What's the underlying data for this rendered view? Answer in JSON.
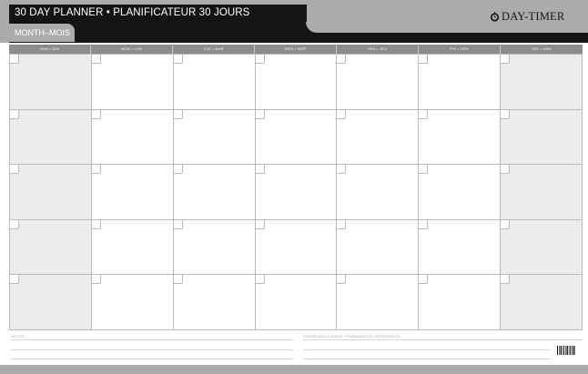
{
  "header": {
    "title": "30 DAY PLANNER • PLANIFICATEUR 30 JOURS",
    "month_label": "MONTH–MOIS",
    "brand": "DAY-TIMER",
    "brand_icon": "clock-icon"
  },
  "days": [
    "SUN • DIM",
    "MON • LUN",
    "TUE • MAR",
    "WED • MER",
    "THU • JEU",
    "FRI • VEN",
    "SAT • SAM"
  ],
  "weeks": 5,
  "notes": {
    "notes_label": "NOTES:",
    "events_label": "IMPORTANT EVENTS / ÉVÉNEMENTS IMPORTANTS:"
  },
  "colors": {
    "header_black": "#141414",
    "header_grey": "#a9abad",
    "weekend_fill": "#ececed",
    "grid_line": "#b8babc"
  }
}
